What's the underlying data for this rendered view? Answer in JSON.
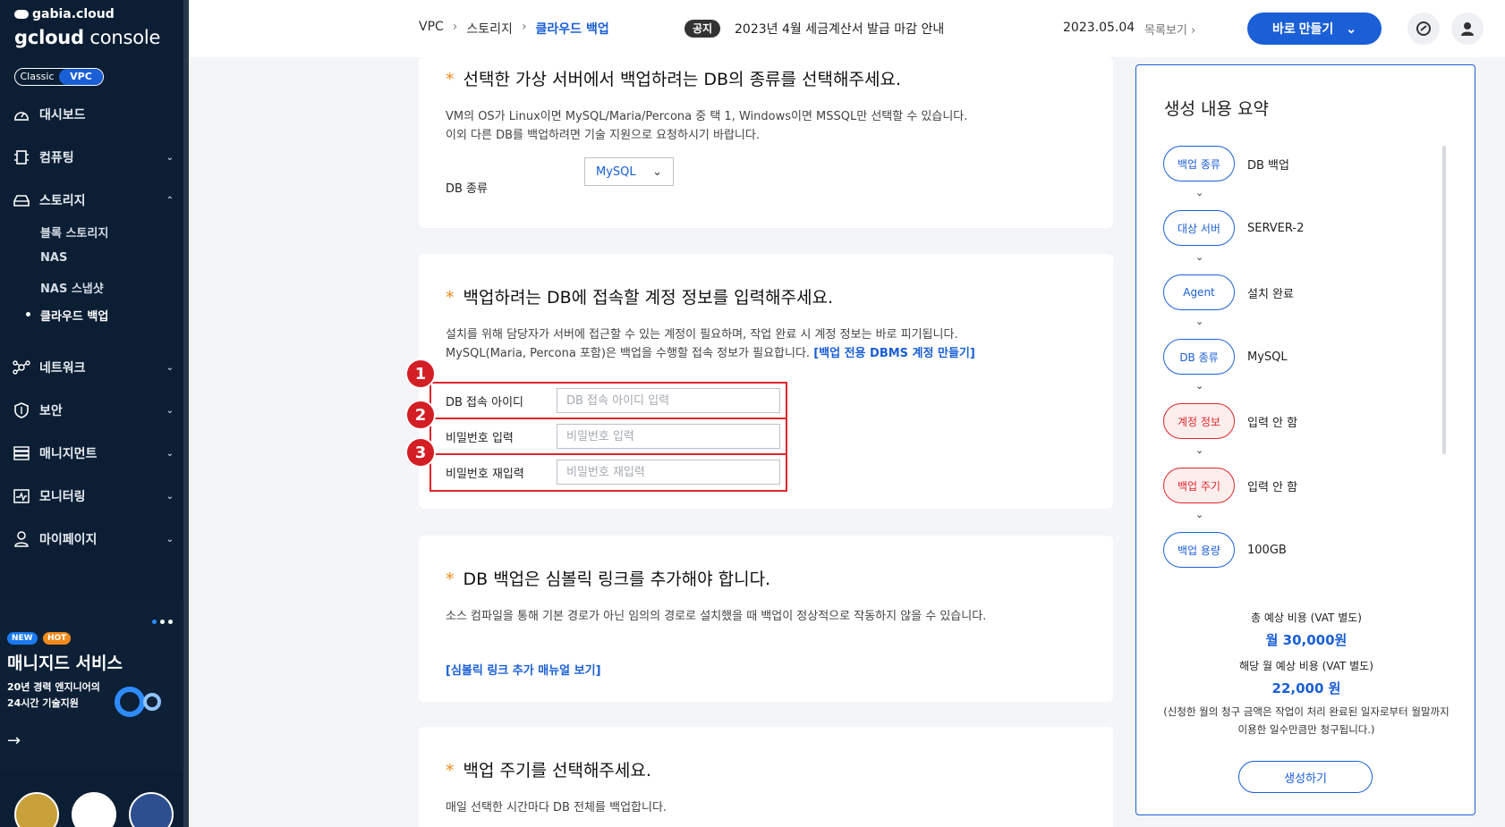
{
  "brand": {
    "top": "gabia.cloud",
    "main_bold": "gcloud",
    "main_light": " console"
  },
  "mode_toggle": {
    "classic": "Classic",
    "vpc": "VPC"
  },
  "nav": {
    "dashboard": "대시보드",
    "computing": "컴퓨팅",
    "storage": "스토리지",
    "storage_sub": [
      "블록 스토리지",
      "NAS",
      "NAS 스냅샷",
      "클라우드 백업"
    ],
    "network": "네트워크",
    "security": "보안",
    "management": "매니지먼트",
    "monitoring": "모니터링",
    "mypage": "마이페이지"
  },
  "promo": {
    "badge_new": "NEW",
    "badge_hot": "HOT",
    "title": "매니지드 서비스",
    "desc_line1": "20년 경력 엔지니어의",
    "desc_line2": "24시간 기술지원",
    "arrow": "→"
  },
  "breadcrumb": [
    "VPC",
    "스토리지",
    "클라우드 백업"
  ],
  "breadcrumb_sep": "›",
  "notice": {
    "tag": "공지",
    "text": "2023년 4월 세금계산서 발급 마감 안내",
    "date": "2023.05.04",
    "list_link": "목록보기 ›"
  },
  "create_now": {
    "label": "바로 만들기",
    "chevron": "⌄"
  },
  "section_db": {
    "star": "*",
    "title": "선택한 가상 서버에서 백업하려는 DB의 종류를 선택해주세요.",
    "desc_line1": "VM의 OS가 Linux이면 MySQL/Maria/Percona 중 택 1, Windows이면 MSSQL만 선택할 수 있습니다.",
    "desc_line2": "이외 다른 DB를 백업하려면 기술 지원으로 요청하시기 바랍니다.",
    "label": "DB 종류",
    "selected": "MySQL",
    "chevron": "⌄"
  },
  "section_account": {
    "star": "*",
    "title": "백업하려는 DB에 접속할 계정 정보를 입력해주세요.",
    "desc_line1": "설치를 위해 담당자가 서버에 접근할 수 있는 계정이 필요하며, 작업 완료 시 계정 정보는 바로 피기됩니다.",
    "desc_line2": "MySQL(Maria, Percona 포함)은 백업을 수행할 접속 정보가 필요합니다. ",
    "link": "[백업 전용 DBMS 계정 만들기]",
    "fields": [
      {
        "marker": "1",
        "label": "DB 접속 아이디",
        "placeholder": "DB 접속 아이디 입력"
      },
      {
        "marker": "2",
        "label": "비밀번호 입력",
        "placeholder": "비밀번호 입력"
      },
      {
        "marker": "3",
        "label": "비밀번호 재입력",
        "placeholder": "비밀번호 재입력"
      }
    ]
  },
  "section_symlink": {
    "star": "*",
    "title": "DB 백업은 심볼릭 링크를 추가해야 합니다.",
    "desc": "소스 컴파일을 통해 기본 경로가 아닌 임의의 경로로 설치했을 때 백업이 정상적으로 작동하지 않을 수 있습니다.",
    "link": "[심볼릭 링크 추가 매뉴얼 보기]"
  },
  "section_cycle": {
    "star": "*",
    "title": "백업 주기를 선택해주세요.",
    "desc": "매일 선택한 시간마다 DB 전체를 백업합니다."
  },
  "summary": {
    "title": "생성 내용 요약",
    "arrow": "⌄",
    "steps": [
      {
        "label": "백업 종류",
        "value": "DB 백업",
        "warn": false
      },
      {
        "label": "대상 서버",
        "value": "SERVER-2",
        "warn": false
      },
      {
        "label": "Agent",
        "value": "설치 완료",
        "warn": false
      },
      {
        "label": "DB 종류",
        "value": "MySQL",
        "warn": false
      },
      {
        "label": "계정 정보",
        "value": "입력 안 함",
        "warn": true
      },
      {
        "label": "백업 주기",
        "value": "입력 안 함",
        "warn": true
      },
      {
        "label": "백업 용량",
        "value": "100GB",
        "warn": false
      }
    ],
    "total_label": "총 예상 비용 (VAT 별도)",
    "total_value": "월 30,000원",
    "month_label": "해당 월 예상 비용 (VAT 별도)",
    "month_value": "22,000 원",
    "note": "(신청한 월의 청구 금액은 작업이 처리 완료된 일자로부터 월말까지 이용한 일수만큼만 청구됩니다.)",
    "create_button": "생성하기"
  },
  "colors": {
    "sidebar": "#0b1e33",
    "accent": "#1a5fd6",
    "highlight": "#e0252b",
    "star": "#f08a1a"
  }
}
